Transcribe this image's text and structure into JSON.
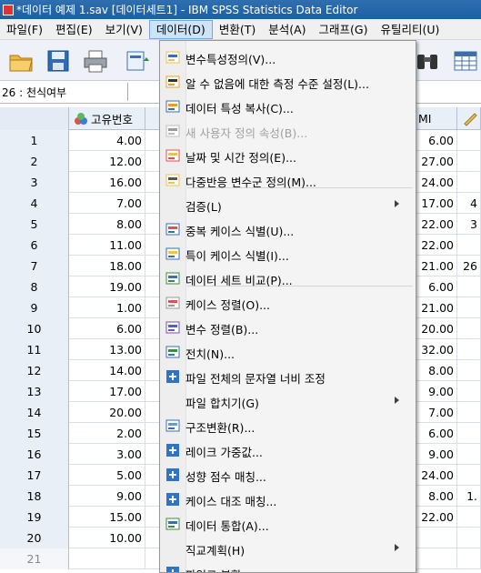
{
  "window": {
    "title": "*데이터 예제 1.sav [데이터세트1] - IBM SPSS Statistics Data Editor"
  },
  "menubar": {
    "items": [
      {
        "label": "파일(F)"
      },
      {
        "label": "편집(E)"
      },
      {
        "label": "보기(V)"
      },
      {
        "label": "데이터(D)"
      },
      {
        "label": "변환(T)"
      },
      {
        "label": "분석(A)"
      },
      {
        "label": "그래프(G)"
      },
      {
        "label": "유틸리티(U)"
      }
    ]
  },
  "cellref": {
    "text": "26 : 천식여부"
  },
  "grid": {
    "columns": [
      "고유번호",
      "MI"
    ],
    "rows": [
      {
        "num": "1",
        "id": "4.00",
        "bmi": "6.00",
        "extra": ""
      },
      {
        "num": "2",
        "id": "12.00",
        "bmi": "27.00",
        "extra": ""
      },
      {
        "num": "3",
        "id": "16.00",
        "bmi": "24.00",
        "extra": ""
      },
      {
        "num": "4",
        "id": "7.00",
        "bmi": "17.00",
        "extra": "4"
      },
      {
        "num": "5",
        "id": "8.00",
        "bmi": "22.00",
        "extra": "3"
      },
      {
        "num": "6",
        "id": "11.00",
        "bmi": "22.00",
        "extra": ""
      },
      {
        "num": "7",
        "id": "18.00",
        "bmi": "21.00",
        "extra": "26"
      },
      {
        "num": "8",
        "id": "19.00",
        "bmi": "6.00",
        "extra": ""
      },
      {
        "num": "9",
        "id": "1.00",
        "bmi": "21.00",
        "extra": ""
      },
      {
        "num": "10",
        "id": "6.00",
        "bmi": "20.00",
        "extra": ""
      },
      {
        "num": "11",
        "id": "13.00",
        "bmi": "32.00",
        "extra": ""
      },
      {
        "num": "12",
        "id": "14.00",
        "bmi": "8.00",
        "extra": ""
      },
      {
        "num": "13",
        "id": "17.00",
        "bmi": "9.00",
        "extra": ""
      },
      {
        "num": "14",
        "id": "20.00",
        "bmi": "7.00",
        "extra": ""
      },
      {
        "num": "15",
        "id": "2.00",
        "bmi": "6.00",
        "extra": ""
      },
      {
        "num": "16",
        "id": "3.00",
        "bmi": "9.00",
        "extra": ""
      },
      {
        "num": "17",
        "id": "5.00",
        "bmi": "24.00",
        "extra": ""
      },
      {
        "num": "18",
        "id": "9.00",
        "bmi": "8.00",
        "extra": "1."
      },
      {
        "num": "19",
        "id": "15.00",
        "bmi": "22.00",
        "extra": ""
      },
      {
        "num": "20",
        "id": "10.00",
        "bmi": "",
        "extra": ""
      },
      {
        "num": "21",
        "id": "",
        "bmi": "",
        "extra": ""
      }
    ]
  },
  "dropdown": {
    "items": [
      {
        "label": "변수특성정의(V)...",
        "icon": "define-variable-properties-icon",
        "disabled": false,
        "submenu": false
      },
      {
        "label": "알 수 없음에 대한 측정 수준 설정(L)...",
        "icon": "measurement-level-icon",
        "disabled": false,
        "submenu": false
      },
      {
        "label": "데이터 특성 복사(C)...",
        "icon": "copy-data-properties-icon",
        "disabled": false,
        "submenu": false
      },
      {
        "label": "새 사용자 정의 속성(B)...",
        "icon": "custom-attribute-icon",
        "disabled": true,
        "submenu": false
      },
      {
        "label": "날짜 및 시간 정의(E)...",
        "icon": "calendar-icon",
        "disabled": false,
        "submenu": false
      },
      {
        "label": "다중반응 변수군 정의(M)...",
        "icon": "multiple-response-icon",
        "disabled": false,
        "submenu": false
      },
      {
        "label": "검증(L)",
        "icon": "",
        "disabled": false,
        "submenu": true
      },
      {
        "label": "중복 케이스 식별(U)...",
        "icon": "duplicate-cases-icon",
        "disabled": false,
        "submenu": false
      },
      {
        "label": "특이 케이스 식별(I)...",
        "icon": "unusual-cases-icon",
        "disabled": false,
        "submenu": false
      },
      {
        "label": "데이터 세트 비교(P)...",
        "icon": "compare-datasets-icon",
        "disabled": false,
        "submenu": false
      },
      {
        "label": "케이스 정렬(O)...",
        "icon": "sort-cases-icon",
        "disabled": false,
        "submenu": false
      },
      {
        "label": "변수 정렬(B)...",
        "icon": "sort-variables-icon",
        "disabled": false,
        "submenu": false
      },
      {
        "label": "전치(N)...",
        "icon": "transpose-icon",
        "disabled": false,
        "submenu": false
      },
      {
        "label": "파일 전체의 문자열 너비 조정",
        "icon": "plus-icon",
        "disabled": false,
        "submenu": false
      },
      {
        "label": "파일 합치기(G)",
        "icon": "",
        "disabled": false,
        "submenu": true
      },
      {
        "label": "구조변환(R)...",
        "icon": "restructure-icon",
        "disabled": false,
        "submenu": false
      },
      {
        "label": "레이크 가중값...",
        "icon": "plus-icon",
        "disabled": false,
        "submenu": false
      },
      {
        "label": "성향 점수 매칭...",
        "icon": "plus-icon",
        "disabled": false,
        "submenu": false
      },
      {
        "label": "케이스 대조 매칭...",
        "icon": "plus-icon",
        "disabled": false,
        "submenu": false
      },
      {
        "label": "데이터 통합(A)...",
        "icon": "aggregate-icon",
        "disabled": false,
        "submenu": false
      },
      {
        "label": "직교계획(H)",
        "icon": "",
        "disabled": false,
        "submenu": true
      },
      {
        "label": "파일로 분할",
        "icon": "plus-icon",
        "disabled": false,
        "submenu": false
      }
    ]
  }
}
